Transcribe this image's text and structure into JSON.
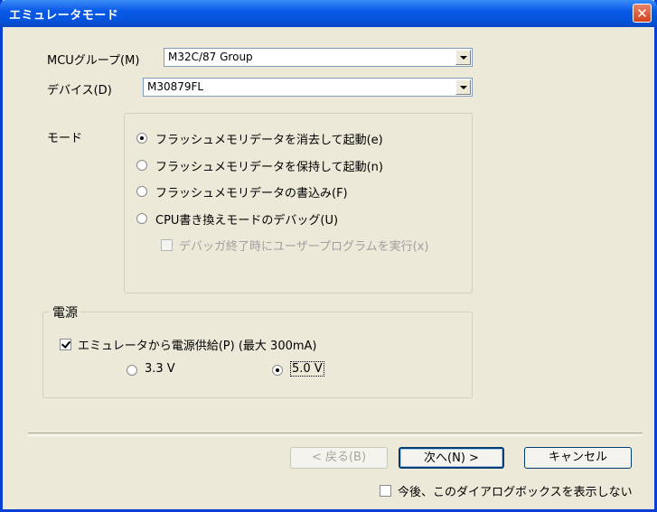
{
  "window": {
    "title": "エミュレータモード",
    "close_glyph": "✕"
  },
  "mcu_group": {
    "label": "MCUグループ(M)",
    "value": "M32C/87 Group"
  },
  "device": {
    "label": "デバイス(D)",
    "value": "M30879FL"
  },
  "mode": {
    "label": "モード",
    "options": [
      {
        "label": "フラッシュメモリデータを消去して起動(e)",
        "selected": true
      },
      {
        "label": "フラッシュメモリデータを保持して起動(n)",
        "selected": false
      },
      {
        "label": "フラッシュメモリデータの書込み(F)",
        "selected": false
      },
      {
        "label": "CPU書き換えモードのデバッグ(U)",
        "selected": false
      }
    ],
    "sub_option": {
      "label": "デバッガ終了時にユーザープログラムを実行(x)",
      "checked": false,
      "enabled": false
    }
  },
  "power": {
    "group_label": "電源",
    "supply_checkbox": {
      "label": "エミュレータから電源供給(P) (最大 300mA)",
      "checked": true
    },
    "voltage_options": [
      {
        "label": "3.3 V",
        "selected": false
      },
      {
        "label": "5.0 V",
        "selected": true
      }
    ]
  },
  "buttons": {
    "back": "< 戻る(B)",
    "next": "次へ(N) >",
    "cancel": "キャンセル"
  },
  "dont_show": {
    "label": "今後、このダイアログボックスを表示しない",
    "checked": false
  }
}
